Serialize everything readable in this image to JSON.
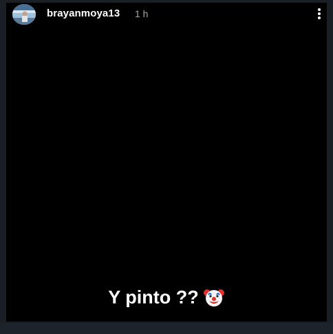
{
  "story": {
    "username": "brayanmoya13",
    "time_ago": "1 h",
    "caption": "Y pinto ??",
    "caption_emoji": "clown-face-icon",
    "avatar_icon": "profile-avatar",
    "menu_icon": "more-vertical-icon"
  }
}
